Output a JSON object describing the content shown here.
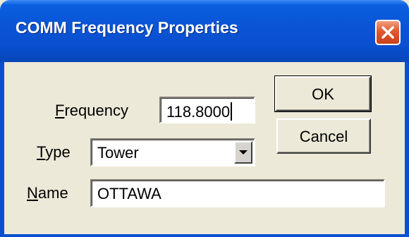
{
  "dialog": {
    "title": "COMM Frequency Properties"
  },
  "fields": {
    "frequency": {
      "label_mnemonic": "F",
      "label_rest": "requency",
      "value": "118.8000"
    },
    "type": {
      "label_mnemonic": "T",
      "label_rest": "ype",
      "value": "Tower"
    },
    "name": {
      "label_mnemonic": "N",
      "label_rest": "ame",
      "value": "OTTAWA"
    }
  },
  "buttons": {
    "ok_label": "OK",
    "cancel_label": "Cancel"
  },
  "icons": {
    "close": "close-icon",
    "dropdown": "chevron-down-icon"
  },
  "colors": {
    "titlebar": "#0a55d6",
    "close_button": "#e0582c",
    "dialog_background": "#ece9d8"
  }
}
